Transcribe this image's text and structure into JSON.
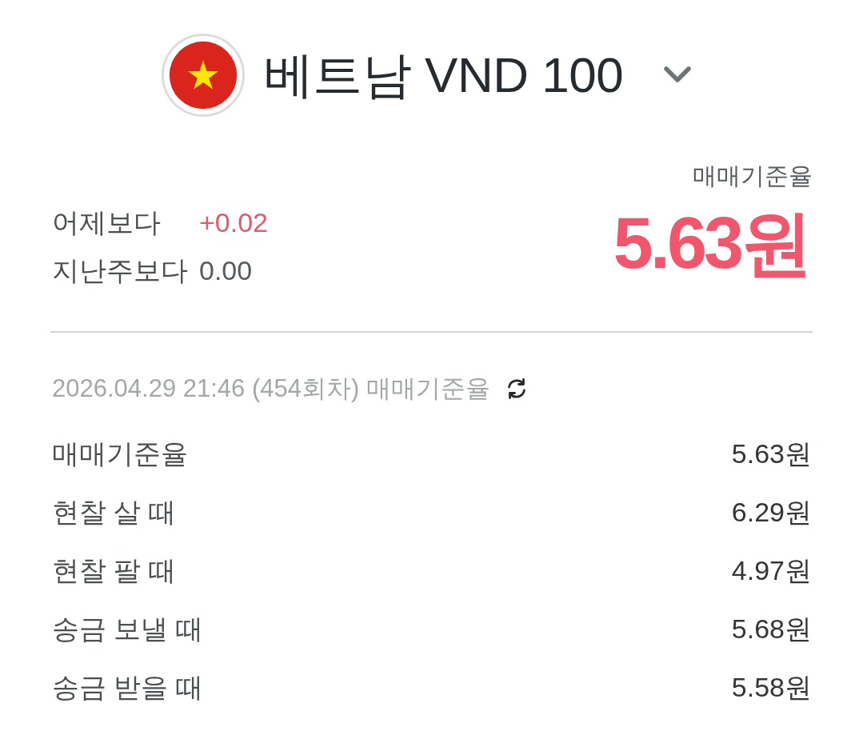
{
  "header": {
    "title": "베트남 VND 100"
  },
  "summary": {
    "changes": [
      {
        "label": "어제보다",
        "value": "+0.02",
        "color": "#e35a6d"
      },
      {
        "label": "지난주보다",
        "value": "0.00",
        "color": "#555b5e"
      }
    ],
    "rate_label": "매매기준율",
    "rate": "5.63원"
  },
  "updated": {
    "text": "2026.04.29 21:46 (454회차) 매매기준율"
  },
  "rates": [
    {
      "label": "매매기준율",
      "value": "5.63원"
    },
    {
      "label": "현찰 살 때",
      "value": "6.29원"
    },
    {
      "label": "현찰 팔 때",
      "value": "4.97원"
    },
    {
      "label": "송금 보낼 때",
      "value": "5.68원"
    },
    {
      "label": "송금 받을 때",
      "value": "5.58원"
    }
  ]
}
